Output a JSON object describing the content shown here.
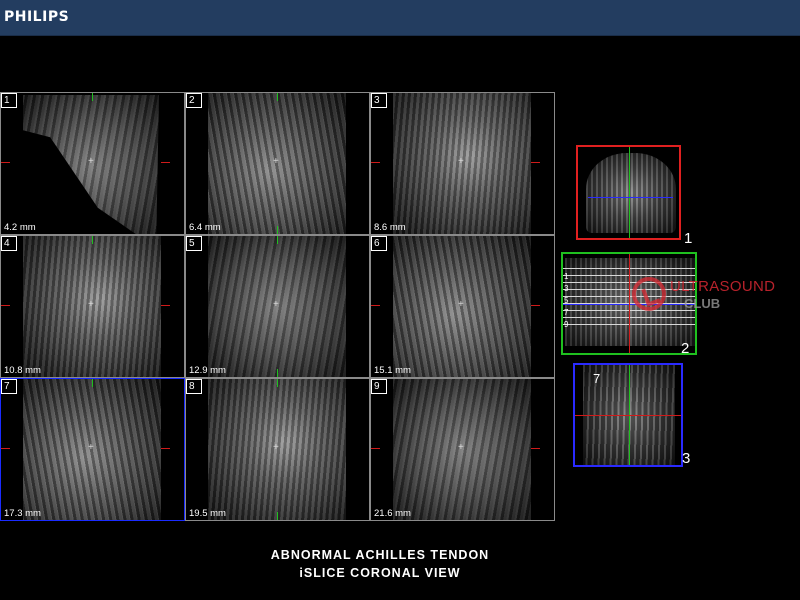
{
  "header": {
    "brand": "PHILIPS",
    "bar_color": "#233d60"
  },
  "slices": [
    {
      "number": "1",
      "depth": "4.2 mm"
    },
    {
      "number": "2",
      "depth": "6.4 mm"
    },
    {
      "number": "3",
      "depth": "8.6 mm"
    },
    {
      "number": "4",
      "depth": "10.8 mm"
    },
    {
      "number": "5",
      "depth": "12.9 mm"
    },
    {
      "number": "6",
      "depth": "15.1 mm"
    },
    {
      "number": "7",
      "depth": "17.3 mm",
      "selected": true
    },
    {
      "number": "8",
      "depth": "19.5 mm"
    },
    {
      "number": "9",
      "depth": "21.6 mm"
    }
  ],
  "reference_views": [
    {
      "label": "1",
      "border_color": "#e02020"
    },
    {
      "label": "2",
      "border_color": "#1fc01f",
      "slice_marks": [
        "1",
        "3",
        "5",
        "7",
        "9"
      ]
    },
    {
      "label": "3",
      "border_color": "#2a2aff",
      "slice_tag": "7"
    }
  ],
  "watermark": {
    "line1": "ULTRASOUND",
    "line2": "CLUB"
  },
  "caption": {
    "line1": "ABNORMAL  ACHILLES  TENDON",
    "line2": "iSLICE  CORONAL  VIEW"
  },
  "colors": {
    "marker_green": "#1fc01f",
    "marker_red": "#d01a1a",
    "selected_blue": "#1a2bff"
  }
}
